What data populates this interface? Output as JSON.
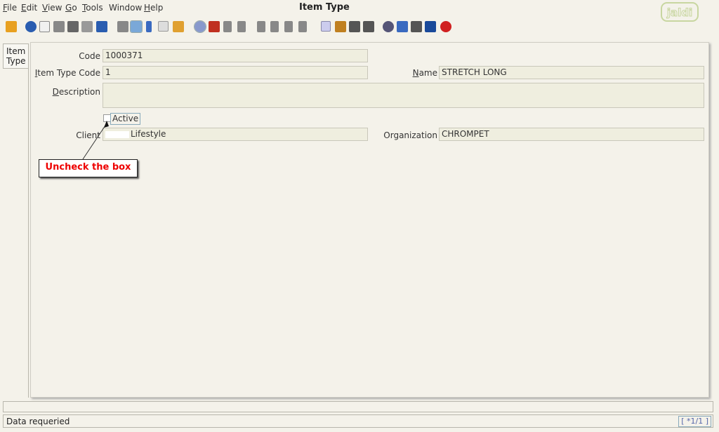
{
  "menu": {
    "file": "File",
    "edit": "Edit",
    "view": "View",
    "go": "Go",
    "tools": "Tools",
    "window": "Window",
    "help": "Help"
  },
  "window_title": "Item Type",
  "logo_text": "jaldi",
  "toolbar_icons": [
    "undo-icon",
    "help-icon",
    "new-icon",
    "copy-icon",
    "delete-icon",
    "delete-selection-icon",
    "save-icon",
    "refresh-icon",
    "find-icon",
    "attachment-icon",
    "chat-icon",
    "grid-toggle-icon",
    "history-icon",
    "home-icon",
    "prev-icon",
    "next-icon",
    "first-icon",
    "up-icon",
    "down-icon",
    "last-icon",
    "report-icon",
    "archive-icon",
    "print-preview-icon",
    "print-icon",
    "zoom-icon",
    "workflow-icon",
    "product-icon",
    "window-icon",
    "close-window-icon"
  ],
  "side_tab": {
    "line1": "Item",
    "line2": "Type"
  },
  "form": {
    "code_label": "Code",
    "code_value": "1000371",
    "item_type_code_label_pre": "I",
    "item_type_code_label_rest": "tem Type Code",
    "item_type_code_value": "1",
    "name_label_pre": "N",
    "name_label_rest": "ame",
    "name_value": "STRETCH LONG",
    "description_label_pre": "D",
    "description_label_rest": "escription",
    "description_value": "",
    "active_label": "Active",
    "active_checked": false,
    "client_label": "Client",
    "client_value": "Lifestyle",
    "organization_label": "Organization",
    "organization_value": "CHROMPET"
  },
  "annotation": {
    "text": "Uncheck the box",
    "color": "#e00000"
  },
  "status": {
    "message": "Data requeried",
    "record": "[ *1/1 ]"
  }
}
